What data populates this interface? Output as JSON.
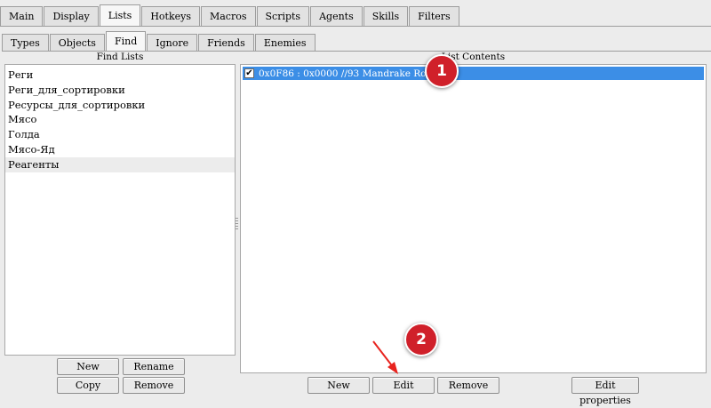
{
  "main_tabs": [
    "Main",
    "Display",
    "Lists",
    "Hotkeys",
    "Macros",
    "Scripts",
    "Agents",
    "Skills",
    "Filters"
  ],
  "main_active": "Lists",
  "sub_tabs": [
    "Types",
    "Objects",
    "Find",
    "Ignore",
    "Friends",
    "Enemies"
  ],
  "sub_active": "Find",
  "find_lists": {
    "header": "Find Lists",
    "items": [
      "Реги",
      "Реги_для_сортировки",
      "Ресурсы_для_сортировки",
      "Мясо",
      "Голда",
      "Мясо-Яд",
      "Реагенты"
    ],
    "selected_index": 6,
    "buttons": {
      "new": "New",
      "rename": "Rename",
      "copy": "Copy",
      "remove": "Remove"
    }
  },
  "list_contents": {
    "header": "List Contents",
    "rows": [
      {
        "checked": true,
        "text": "0x0F86 : 0x0000 //93 Mandrake Root"
      }
    ],
    "buttons": {
      "new": "New",
      "edit": "Edit",
      "remove": "Remove",
      "edit_properties": "Edit properties"
    }
  },
  "annotations": {
    "badge1": "1",
    "badge2": "2"
  },
  "colors": {
    "selection": "#3c8ee6",
    "badge": "#d0202a",
    "arrow": "#e8231e"
  }
}
